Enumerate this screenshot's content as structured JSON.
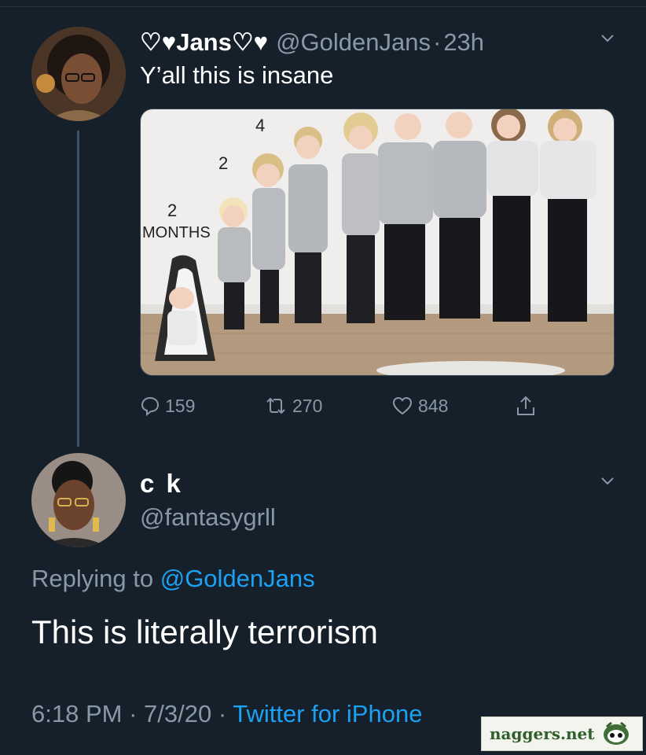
{
  "tweet1": {
    "display_name": "♡♥Jans♡♥",
    "handle": "@GoldenJans",
    "separator": "·",
    "time": "23h",
    "text": "Y’all this is insane",
    "photo_labels": [
      "4",
      "2",
      "2",
      "MONTHS"
    ],
    "actions": {
      "replies": "159",
      "retweets": "270",
      "likes": "848"
    }
  },
  "tweet2": {
    "display_name": "c k",
    "handle": "@fantasygrll",
    "replying_prefix": "Replying to ",
    "replying_to": "@GoldenJans",
    "text": "This is literally terrorism",
    "time": "6:18 PM",
    "separator": " · ",
    "date": "7/3/20",
    "source": "Twitter for iPhone"
  },
  "watermark": {
    "text": "naggers.net"
  },
  "icons": {
    "menu": "chevron-down-icon",
    "reply": "speech-bubble-icon",
    "retweet": "retweet-icon",
    "like": "heart-icon",
    "share": "share-icon"
  },
  "colors": {
    "background": "#15202b",
    "secondary_text": "#8899a6",
    "link": "#1da1f2",
    "divider": "#38444d"
  }
}
